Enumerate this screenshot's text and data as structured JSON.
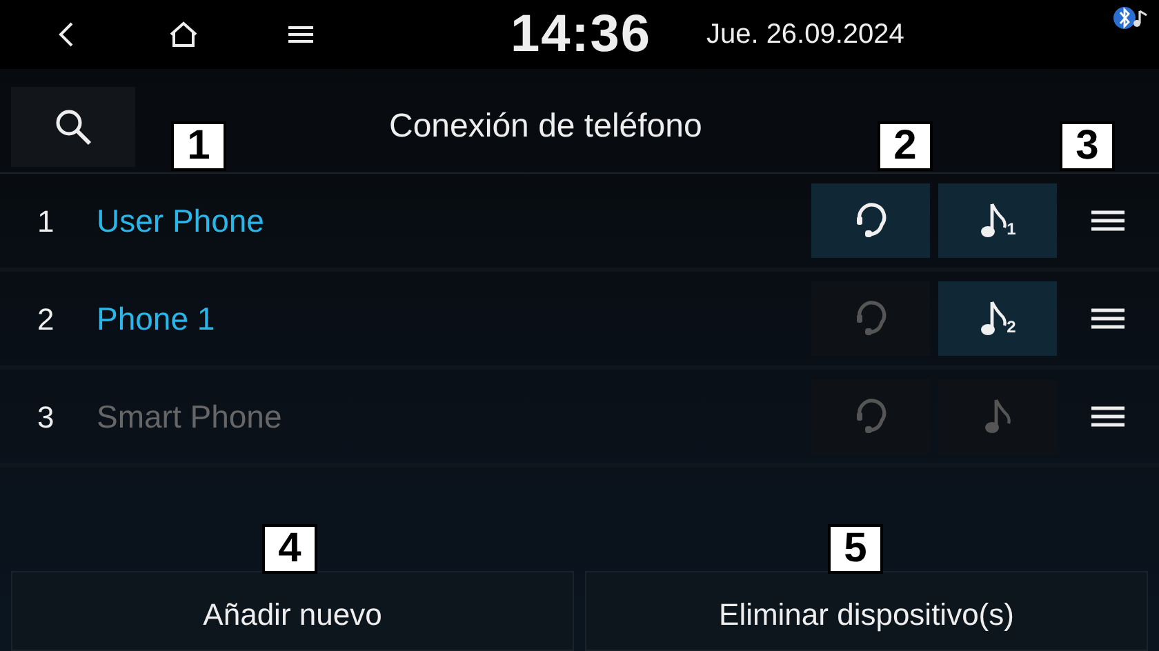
{
  "status_bar": {
    "time": "14:36",
    "date": "Jue. 26.09.2024"
  },
  "title": "Conexión de teléfono",
  "devices": [
    {
      "number": "1",
      "name": "User Phone",
      "connected": true,
      "handsfree": true,
      "audio": true,
      "audio_slot": "1"
    },
    {
      "number": "2",
      "name": "Phone 1",
      "connected": true,
      "handsfree": false,
      "audio": true,
      "audio_slot": "2"
    },
    {
      "number": "3",
      "name": "Smart Phone",
      "connected": false,
      "handsfree": false,
      "audio": false
    }
  ],
  "buttons": [
    "Añadir nuevo",
    "Eliminar dispositivo(s)"
  ],
  "callouts": [
    "1",
    "2",
    "3",
    "4",
    "5"
  ]
}
